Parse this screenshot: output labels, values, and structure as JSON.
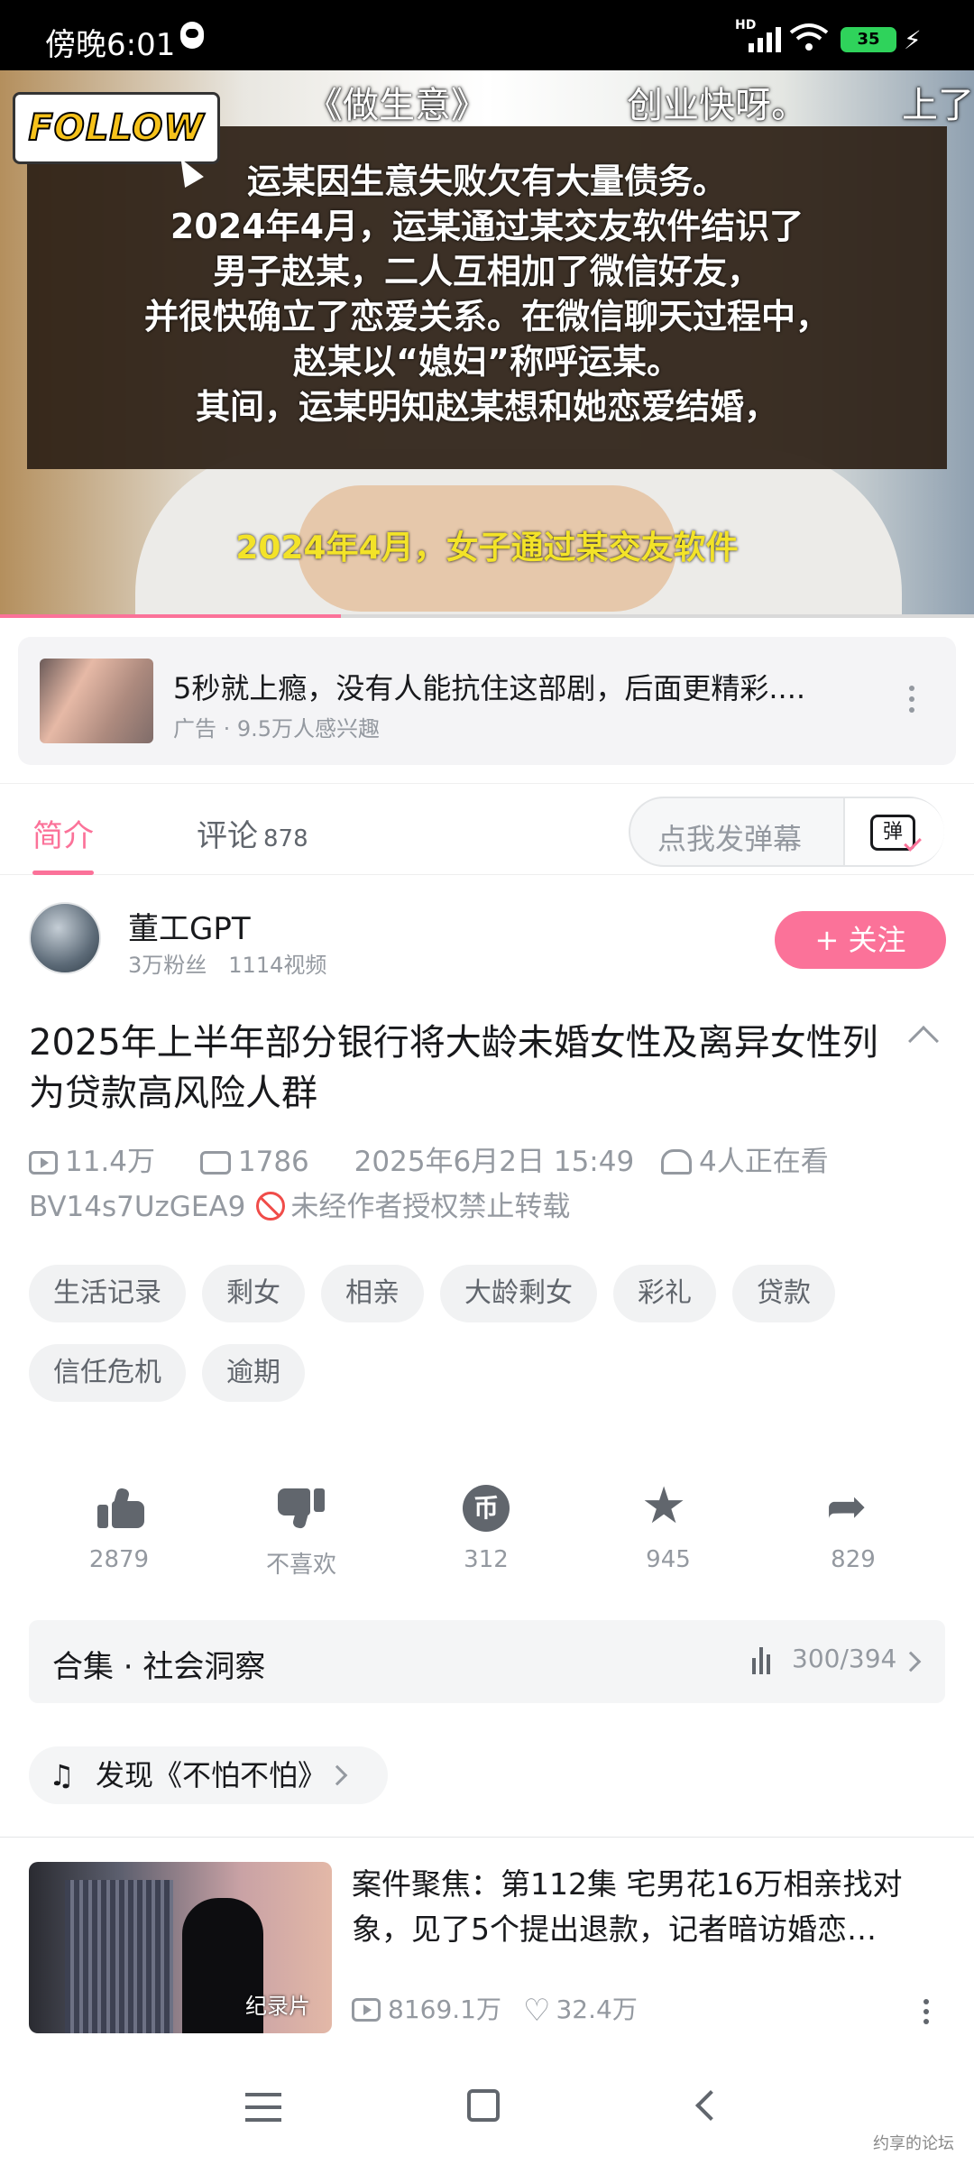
{
  "status_bar": {
    "time": "傍晚6:01",
    "hd": "HD",
    "battery": "35"
  },
  "video": {
    "top_left_text": "《做生意》",
    "top_right_text": "创业快呀。",
    "top_right_tail": "上了",
    "follow_sticker": "FOLLOW",
    "news_text": "运某因生意失败欠有大量债务。\n2024年4月，运某通过某交友软件结识了\n男子赵某，二人互相加了微信好友，\n并很快确立了恋爱关系。在微信聊天过程中，\n赵某以“媳妇”称呼运某。\n其间，运某明知赵某想和她恋爱结婚，",
    "subtitle": "2024年4月，女子通过某交友软件",
    "progress": 0.35
  },
  "ad": {
    "title": "5秒就上瘾，没有人能抗住这部剧，后面更精彩....",
    "sub": "广告 · 9.5万人感兴趣"
  },
  "tabs": {
    "intro": "简介",
    "comments": "评论",
    "comments_count": "878"
  },
  "danmu": {
    "placeholder": "点我发弹幕",
    "button": "弹"
  },
  "author": {
    "name": "董工GPT",
    "fans": "3万粉丝",
    "videos": "1114视频",
    "follow": "+ 关注"
  },
  "video_info": {
    "title": "2025年上半年部分银行将大龄未婚女性及离异女性列为贷款高风险人群",
    "plays": "11.4万",
    "danmaku": "1786",
    "date": "2025年6月2日 15:49",
    "watching": "4人正在看",
    "bvid": "BV14s7UzGEA9",
    "copyright": "未经作者授权禁止转载"
  },
  "tags": [
    "生活记录",
    "剩女",
    "相亲",
    "大龄剩女",
    "彩礼",
    "贷款",
    "信任危机",
    "逾期"
  ],
  "actions": {
    "like": "2879",
    "dislike": "不喜欢",
    "coin": "312",
    "favorite": "945",
    "share": "829"
  },
  "collection": {
    "label": "合集 · 社会洞察",
    "progress": "300/394"
  },
  "discover": {
    "label": "发现《不怕不怕》"
  },
  "recommend": {
    "title": "案件聚焦：第112集 宅男花16万相亲找对象，见了5个提出退款，记者暗访婚恋…",
    "thumb_label": "纪录片",
    "plays": "8169.1万",
    "likes": "32.4万"
  },
  "watermark": "约享的论坛"
}
